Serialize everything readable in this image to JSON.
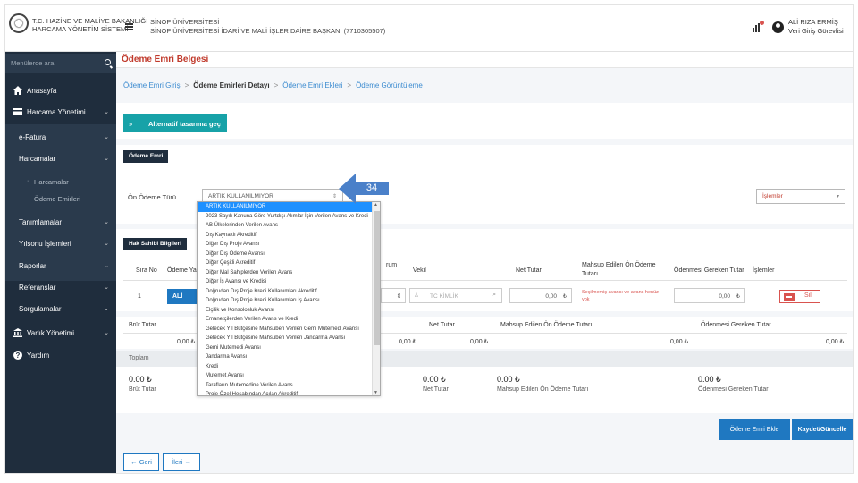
{
  "brand": {
    "line1": "T.C. HAZİNE VE MALİYE BAKANLIĞI",
    "line2": "HARCAMA YÖNETİM SİSTEMİ"
  },
  "organization": {
    "line1": "SİNOP ÜNİVERSİTESİ",
    "line2": "SİNOP ÜNİVERSİTESİ İDARİ VE MALİ İŞLER DAİRE BAŞKAN. (7710305507)"
  },
  "user": {
    "name": "ALİ RIZA ERMİŞ",
    "role": "Veri Giriş Görevlisi"
  },
  "sidebar": {
    "search_placeholder": "Menülerde ara",
    "items": [
      {
        "label": "Anasayfa",
        "icon": "home-icon"
      },
      {
        "label": "Harcama Yönetimi",
        "icon": "card-icon"
      },
      {
        "label": "e-Fatura"
      },
      {
        "label": "Harcamalar"
      },
      {
        "label": "Harcamalar"
      },
      {
        "label": "Ödeme Emirleri"
      },
      {
        "label": "Tanımlamalar"
      },
      {
        "label": "Yılsonu İşlemleri"
      },
      {
        "label": "Raporlar"
      },
      {
        "label": "Referanslar"
      },
      {
        "label": "Sorgulamalar"
      },
      {
        "label": "Varlık Yönetimi",
        "icon": "bank-icon"
      },
      {
        "label": "Yardım",
        "icon": "help-icon"
      }
    ]
  },
  "page": {
    "title": "Ödeme Emri Belgesi",
    "breadcrumb": [
      "Ödeme Emri Giriş",
      "Ödeme Emirleri Detayı",
      "Ödeme Emri Ekleri",
      "Ödeme Görüntüleme"
    ],
    "alt_button": "Alternatif tasarıma geç",
    "alt_button_icon": "»",
    "section_payment": "Ödeme Emri",
    "section_beneficiary": "Hak Sahibi Bilgileri",
    "pre_payment_label": "Ön Ödeme Türü",
    "pre_payment_value": "ARTIK KULLANILMIYOR",
    "operations_select": "İşlemler",
    "callout": "34"
  },
  "dropdown_options": [
    "ARTIK KULLANILMIYOR",
    "2023 Sayılı Kanuna Göre Yurtdışı Alımlar İçin Verilen Avans ve Kredi",
    "AB Ülkelerinden Verilen Avans",
    "Dış Kaynaklı Akreditif",
    "Diğer Dış Proje Avansı",
    "Diğer Dış Ödeme Avansı",
    "Diğer Çeşitli Akreditif",
    "Diğer Mal Sahiplerden Verilen Avans",
    "Diğer İş Avansı ve Kredisi",
    "Doğrudan Dış Proje Kredi Kullanımları Akreditif",
    "Doğrudan Dış Proje Kredi Kullanımları İş Avansı",
    "Elçilik ve Konsolosluk Avansı",
    "Emanetçilerden Verilen Avans ve Kredi",
    "Gelecek Yıl Bütçesine Mahsuben Verilen Gemi Mutemedi Avansı",
    "Gelecek Yıl Bütçesine Mahsuben Verilen Jandarma Avansı",
    "Gemi Mutemedi Avansı",
    "Jandarma Avansı",
    "Kredi",
    "Mutemet Avansı",
    "Tarafların Mutemedine Verilen Avans",
    "Proje Özel Hesabından Açılan Akreditif"
  ],
  "beneficiary_table": {
    "headers": [
      "Sıra No",
      "Ödeme Yapıl",
      "rum",
      "Vekil",
      "Net Tutar",
      "Mahsup Edilen Ön Ödeme Tutarı",
      "Ödenmesi Gereken Tutar",
      "İşlemler"
    ],
    "row": {
      "no": "1",
      "name_button": "ALİ RIZAER",
      "vekil_placeholder": "TC KİMLİK",
      "net": "0,00",
      "note": "Seçilmemiş avansı ve avans henüz yok",
      "due": "0,00",
      "delete_label": "Sil"
    }
  },
  "summary_table": {
    "headers": [
      "Brüt Tutar",
      "Net Tutar",
      "Mahsup Edilen Ön Ödeme Tutarı",
      "Ödenmesi Gereken Tutar"
    ],
    "values": [
      "0,00",
      "0,00",
      "0,00",
      "0,00",
      "0,00",
      "0,00"
    ]
  },
  "totals": {
    "heading": "Toplam",
    "items": [
      {
        "value": "0.00 ₺",
        "label": "Brüt Tutar"
      },
      {
        "value": "0.00 ₺",
        "label": "Net Tutar"
      },
      {
        "value": "0.00 ₺",
        "label": "Mahsup Edilen Ön Ödeme Tutarı"
      },
      {
        "value": "0.00 ₺",
        "label": "Ödenmesi Gereken Tutar"
      }
    ]
  },
  "actions": {
    "add": "Ödeme Emri Ekle",
    "save": "Kaydet/Güncelle",
    "back": "← Geri",
    "next": "İleri →"
  },
  "currency_symbol": "₺",
  "colors": {
    "sidebar": "#1f2d3d",
    "accent": "#17a2a8",
    "primary": "#1f78c1",
    "title": "#c0392b",
    "callout": "#4a80c9"
  }
}
